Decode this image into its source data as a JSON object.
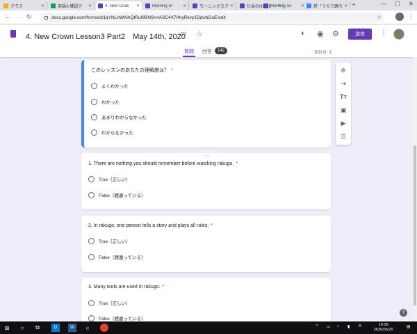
{
  "browser": {
    "tabs": [
      {
        "label": "クラス",
        "color": "#f4b400"
      },
      {
        "label": "英語A 確認テ",
        "color": "#0f9d58"
      },
      {
        "label": "4. New Crow",
        "color": "#673ab7",
        "active": true
      },
      {
        "label": "Morning Sl",
        "color": "#673ab7"
      },
      {
        "label": "モーニングスク",
        "color": "#673ab7"
      },
      {
        "label": "社会のNITSE",
        "color": "#673ab7"
      },
      {
        "label": "Morning Sli",
        "color": "#673ab7"
      },
      {
        "label": "終「うちで踊ろ",
        "color": "#4285f4"
      }
    ],
    "new_tab": "+",
    "window_controls": {
      "minimize": "—",
      "maximize": "☐",
      "close": "✕"
    },
    "url": "docs.google.com/forms/d/1qYNLnWKihQtRuI9BNSrvIASC4X7AhyRkvy1DjnvbGuE/edit"
  },
  "header": {
    "title": "4. New Crown Lesson3 Part2　May 14th, 2020",
    "send_label": "送信",
    "tabs": {
      "questions": "質問",
      "responses": "回答",
      "response_count": "142"
    },
    "total_points": "合計点: 3"
  },
  "cards": [
    {
      "title": "このレッスンのあなたの理解度は？",
      "required": "*",
      "options": [
        "よくわかった",
        "わかった",
        "あまりわからなかった",
        "わからなかった"
      ]
    },
    {
      "title": "1. There are nothing you should remember before watching rakugo.",
      "required": "*",
      "options": [
        "True（正しい）",
        "False（間違っている）"
      ]
    },
    {
      "title": "2. In rakugo, one person tells a story and plays all roles.",
      "required": "*",
      "options": [
        "True（正しい）",
        "False（間違っている）"
      ]
    },
    {
      "title": "3. Many tools are used in rakugo.",
      "required": "*",
      "options": [
        "True（正しい）",
        "False（間違っている）"
      ]
    }
  ],
  "toolbar_icons": [
    "add-question-icon",
    "import-questions-icon",
    "add-title-icon",
    "add-image-icon",
    "add-video-icon",
    "add-section-icon"
  ],
  "help": "?",
  "taskbar": {
    "time": "10:36",
    "date": "2020/05/20",
    "ime": "A"
  }
}
